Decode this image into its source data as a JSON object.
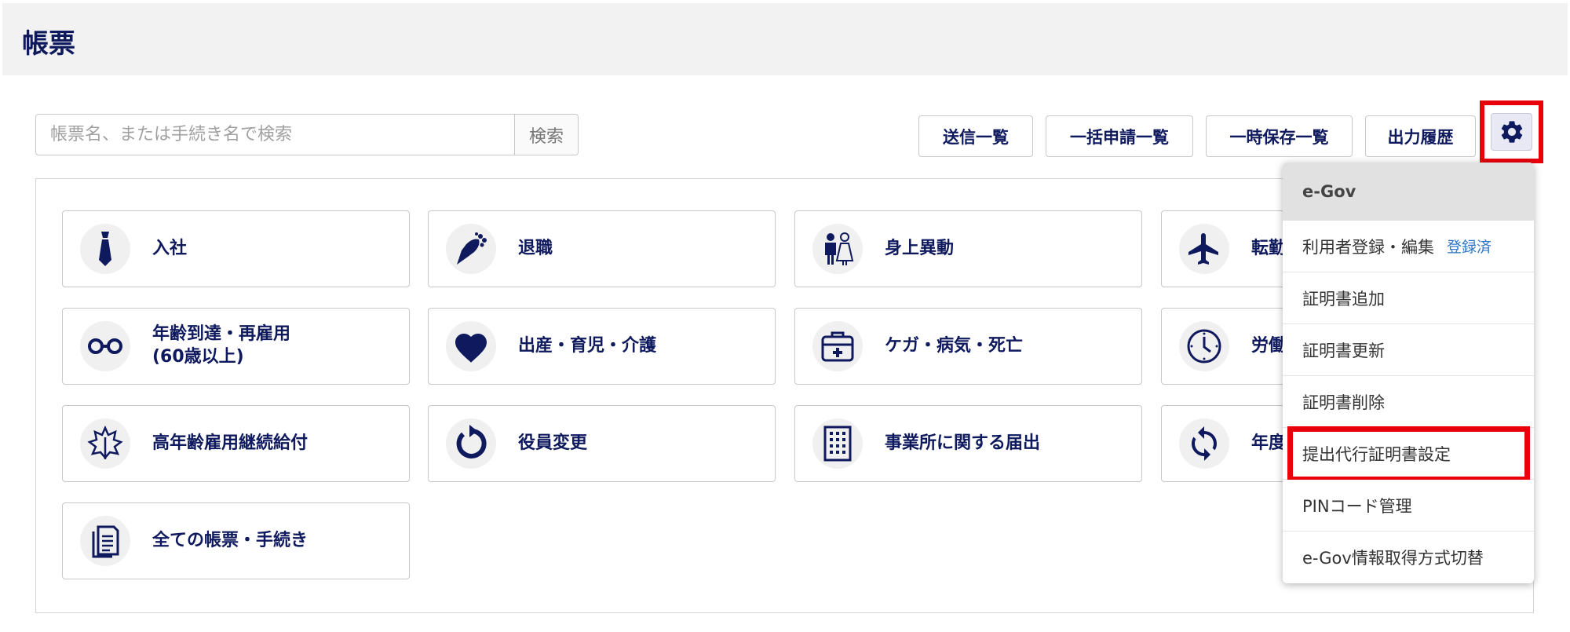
{
  "header": {
    "title": "帳票"
  },
  "search": {
    "placeholder": "帳票名、または手続き名で検索",
    "button_label": "検索"
  },
  "toolbar": {
    "send_list": "送信一覧",
    "bulk_list": "一括申請一覧",
    "temp_list": "一時保存一覧",
    "output_history": "出力履歴"
  },
  "cards": [
    {
      "label": "入社",
      "icon": "necktie-icon"
    },
    {
      "label": "退職",
      "icon": "bouquet-icon"
    },
    {
      "label": "身上異動",
      "icon": "couple-icon"
    },
    {
      "label": "転勤",
      "icon": "airplane-icon"
    },
    {
      "label": "年齢到達・再雇用\n(60歳以上)",
      "icon": "glasses-icon"
    },
    {
      "label": "出産・育児・介護",
      "icon": "heart-icon"
    },
    {
      "label": "ケガ・病気・死亡",
      "icon": "first-aid-kit-icon"
    },
    {
      "label": "労働",
      "icon": "clock-icon"
    },
    {
      "label": "高年齢雇用継続給付",
      "icon": "leaf-icon"
    },
    {
      "label": "役員変更",
      "icon": "refresh-icon"
    },
    {
      "label": "事業所に関する届出",
      "icon": "building-icon"
    },
    {
      "label": "年度",
      "icon": "sync-icon"
    },
    {
      "label": "全ての帳票・手続き",
      "icon": "documents-icon"
    }
  ],
  "menu": {
    "header": "e-Gov",
    "items": [
      {
        "label": "利用者登録・編集",
        "badge": "登録済"
      },
      {
        "label": "証明書追加"
      },
      {
        "label": "証明書更新"
      },
      {
        "label": "証明書削除"
      },
      {
        "label": "提出代行証明書設定"
      },
      {
        "label": "PINコード管理"
      },
      {
        "label": "e-Gov情報取得方式切替"
      }
    ]
  },
  "colors": {
    "navy": "#0f1a5e",
    "highlight": "#e8000b",
    "badge": "#2f74c8"
  }
}
